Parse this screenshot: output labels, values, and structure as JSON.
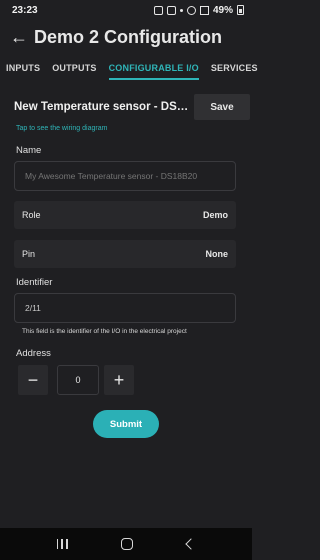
{
  "status_bar": {
    "time": "23:23",
    "battery": "49%"
  },
  "header": {
    "back_icon": "arrow-left-icon",
    "title": "Demo 2 Configuration"
  },
  "tabs": [
    {
      "label": "INPUTS",
      "active": false
    },
    {
      "label": "OUTPUTS",
      "active": false
    },
    {
      "label": "CONFIGURABLE I/O",
      "active": true
    },
    {
      "label": "SERVICES",
      "active": false
    }
  ],
  "panel": {
    "title": "New Temperature sensor - DS18B...",
    "save_label": "Save",
    "wiring_link": "Tap to see the wiring diagram"
  },
  "form": {
    "name_label": "Name",
    "name_placeholder": "My Awesome Temperature sensor - DS18B20",
    "role_label": "Role",
    "role_value": "Demo",
    "pin_label": "Pin",
    "pin_value": "None",
    "identifier_label": "Identifier",
    "identifier_value": "2/11",
    "identifier_helper": "This field is the identifier of the I/O in the electrical project",
    "address_label": "Address",
    "address_value": "0",
    "decrement_glyph": "−",
    "increment_glyph": "+",
    "submit_label": "Submit"
  },
  "colors": {
    "accent": "#2fb5b8",
    "background": "#1f1f22",
    "submit": "#2bb0b6"
  }
}
